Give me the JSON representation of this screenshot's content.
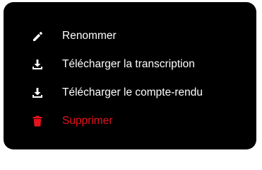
{
  "menu": {
    "items": [
      {
        "label": "Renommer",
        "icon": "pencil-icon"
      },
      {
        "label": "Télécharger la transcription",
        "icon": "download-icon"
      },
      {
        "label": "Télécharger le compte-rendu",
        "icon": "download-icon"
      },
      {
        "label": "Supprimer",
        "icon": "trash-icon",
        "color": "#e8121c"
      }
    ]
  },
  "colors": {
    "menu_background": "#000000",
    "text": "#ffffff",
    "danger": "#e8121c"
  }
}
